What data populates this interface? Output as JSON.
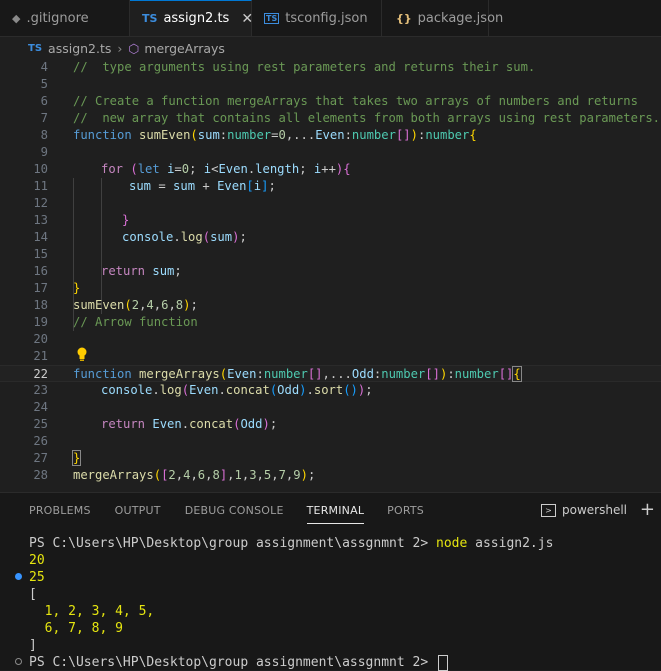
{
  "tabs": [
    {
      "icon": "◆",
      "label": ".gitignore"
    },
    {
      "icon": "TS",
      "label": "assign2.ts"
    },
    {
      "icon": "TS",
      "label": "tsconfig.json"
    },
    {
      "icon": "{}",
      "label": "package.json"
    }
  ],
  "breadcrumb": {
    "file_icon": "TS",
    "file": "assign2.ts",
    "symbol": "mergeArrays"
  },
  "line_numbers": [
    "4",
    "5",
    "6",
    "7",
    "8",
    "9",
    "10",
    "11",
    "12",
    "13",
    "14",
    "15",
    "16",
    "17",
    "18",
    "19",
    "20",
    "21",
    "22",
    "23",
    "24",
    "25",
    "26",
    "27",
    "28"
  ],
  "code": {
    "l4": "//  type arguments using rest parameters and returns their sum.",
    "l6": "// Create a function mergeArrays that takes two arrays of numbers and returns",
    "l7": "//  new array that contains all elements from both arrays using rest parameters.",
    "l19": "// Arrow function"
  },
  "panel_tabs": [
    "PROBLEMS",
    "OUTPUT",
    "DEBUG CONSOLE",
    "TERMINAL",
    "PORTS"
  ],
  "shell_label": "powershell",
  "terminal": {
    "prompt1": "PS C:\\Users\\HP\\Desktop\\group assignment\\assgnmnt 2> ",
    "cmd": "node",
    "arg": " assign2.js",
    "out1": "20",
    "out2": "25",
    "out3": "[",
    "out4": "  1, 2, 3, 4, 5,",
    "out5": "  6, 7, 8, 9",
    "out6": "]",
    "prompt2": "PS C:\\Users\\HP\\Desktop\\group assignment\\assgnmnt 2> "
  }
}
